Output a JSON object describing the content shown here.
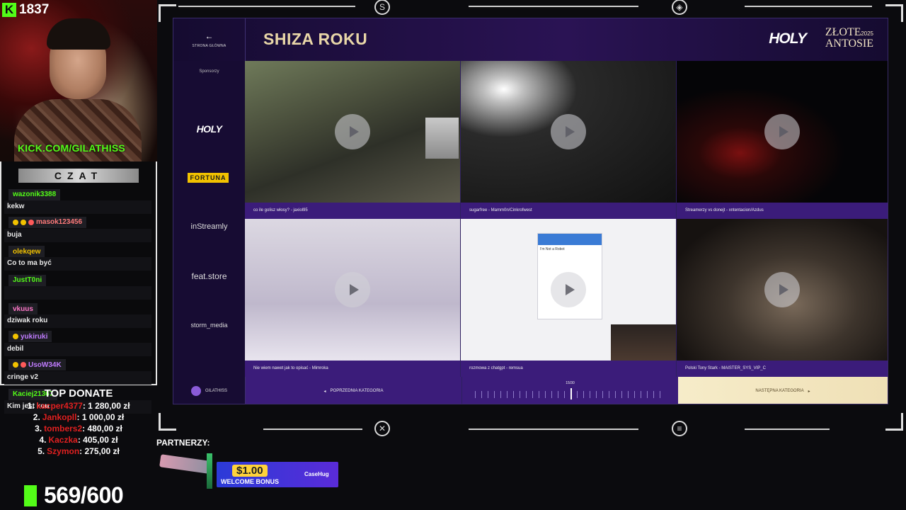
{
  "viewers": "1837",
  "kick_url": "KICK.COM/GILATHISS",
  "chat": {
    "title": "CZAT",
    "messages": [
      {
        "user": "wazonik3388",
        "text": "kekw",
        "color": "#53fc18",
        "badges": []
      },
      {
        "user": "masok123456",
        "text": "buja",
        "color": "#ff7a7a",
        "badges": [
          "#f2c200",
          "#f2c200",
          "#ff5a5a"
        ]
      },
      {
        "user": "olekqew",
        "text": "Co to ma być",
        "color": "#f2c200",
        "badges": []
      },
      {
        "user": "JustT0ni",
        "text": "",
        "color": "#53fc18",
        "badges": []
      },
      {
        "user": "vkuus",
        "text": "dziwak roku",
        "color": "#ff77c8",
        "badges": []
      },
      {
        "user": "yukiruki",
        "text": "debil",
        "color": "#c07cff",
        "badges": [
          "#f2c200"
        ]
      },
      {
        "user": "UsoW34K",
        "text": "cringe v2",
        "color": "#c07cff",
        "badges": [
          "#f2c200",
          "#ff5a5a"
        ]
      },
      {
        "user": "Kaciej21367",
        "text": "Kim jest kou",
        "color": "#53fc18",
        "badges": []
      }
    ]
  },
  "top_donate": {
    "title": "TOP DONATE",
    "rows": [
      {
        "rank": "1.",
        "name": "kacper4377",
        "amount": ": 1 280,00 zł"
      },
      {
        "rank": "2.",
        "name": "Jankopll",
        "amount": ": 1 000,00 zł"
      },
      {
        "rank": "3.",
        "name": "tombers2",
        "amount": ": 480,00 zł"
      },
      {
        "rank": "4.",
        "name": "Kaczka",
        "amount": ": 405,00 zł"
      },
      {
        "rank": "5.",
        "name": "Szymon",
        "amount": ": 275,00 zł"
      }
    ]
  },
  "goal": "569/600",
  "partners_label": "PARTNERZY:",
  "promo": {
    "amount": "$1.00",
    "bonus": "WELCOME BONUS",
    "brand": "CaseHug"
  },
  "app": {
    "back_label": "STRONA GŁÓWNA",
    "title": "SHIZA ROKU",
    "brand": "HOLY",
    "event_line1": "ZŁOTE",
    "event_line2": "ANTOSIE",
    "event_year": "2025",
    "sponsors_label": "Sponsorzy",
    "sponsors": {
      "holy": "HOLY",
      "fortuna": "FORTUNA",
      "instreamly": "inStreamly",
      "feat": "feat.store",
      "storm": "storm_media"
    },
    "user_name": "GILATHISS",
    "prev_label": "POPRZEDNIA KATEGORIA",
    "next_label": "NASTĘPNA KATEGORIA",
    "progress_label": "15/30",
    "progress": 0.5
  },
  "tiles": [
    {
      "caption": "co ile golisz włosy? - jaxiol95"
    },
    {
      "caption": "sugarfree - Mamm0n/Cinkrofwest"
    },
    {
      "caption": "Streamerzy vs donejt - xntentacion/Azdus"
    },
    {
      "caption": "Nie wiem nawet jak to opisać - Mimroka"
    },
    {
      "caption": "rozmowa z chatgpt - remsua"
    },
    {
      "caption": "Polski Tony Stark - MAISTER_SYS_VIP_C"
    }
  ],
  "tile5_card_header": "I'm Not a Robot"
}
